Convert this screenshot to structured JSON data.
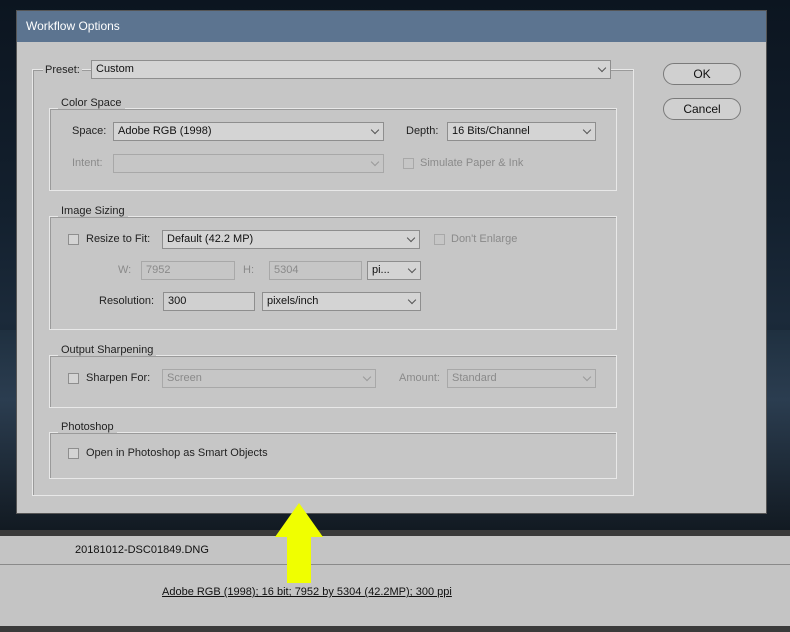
{
  "dialog": {
    "title": "Workflow Options",
    "buttons": {
      "ok": "OK",
      "cancel": "Cancel"
    },
    "preset": {
      "label": "Preset:",
      "value": "Custom"
    },
    "color_space": {
      "title": "Color Space",
      "space_label": "Space:",
      "space_value": "Adobe RGB (1998)",
      "depth_label": "Depth:",
      "depth_value": "16 Bits/Channel",
      "intent_label": "Intent:",
      "intent_value": "",
      "simulate_label": "Simulate Paper & Ink"
    },
    "image_sizing": {
      "title": "Image Sizing",
      "resize_label": "Resize to Fit:",
      "resize_value": "Default  (42.2 MP)",
      "dont_enlarge_label": "Don't Enlarge",
      "w_label": "W:",
      "w_value": "7952",
      "h_label": "H:",
      "h_value": "5304",
      "unit_value": "pi...",
      "resolution_label": "Resolution:",
      "resolution_value": "300",
      "resolution_unit": "pixels/inch"
    },
    "output_sharpening": {
      "title": "Output Sharpening",
      "sharpen_label": "Sharpen For:",
      "sharpen_value": "Screen",
      "amount_label": "Amount:",
      "amount_value": "Standard"
    },
    "photoshop": {
      "title": "Photoshop",
      "smart_objects_label": "Open in Photoshop as Smart Objects"
    }
  },
  "footer": {
    "filename": "20181012-DSC01849.DNG",
    "workflow_summary": "Adobe RGB (1998); 16 bit; 7952 by 5304 (42.2MP); 300 ppi"
  },
  "colors": {
    "titlebar": "#5c7490",
    "dialog_bg": "#c6c6c6",
    "arrow": "#f0ff00"
  },
  "icons": [
    "chevron-down-icon",
    "arrow-up-icon"
  ]
}
